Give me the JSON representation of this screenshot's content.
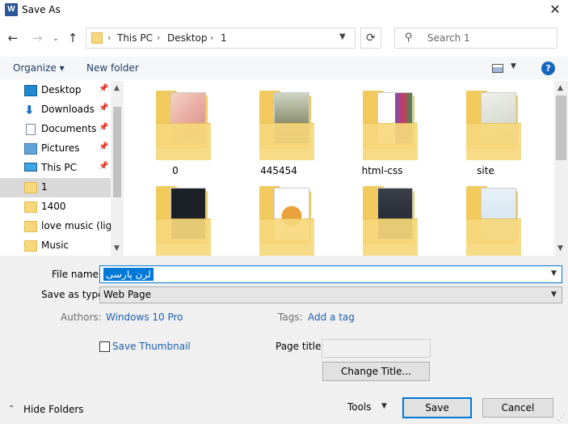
{
  "window": {
    "title": "Save As",
    "app_icon": "word-icon",
    "app_icon_letter": "W"
  },
  "nav": {
    "breadcrumbs": [
      "This PC",
      "Desktop",
      "1"
    ],
    "search_placeholder": "Search 1"
  },
  "toolbar": {
    "organize": "Organize",
    "new_folder": "New folder",
    "help": "?"
  },
  "sidebar": {
    "items": [
      {
        "label": "Desktop",
        "icon": "desktop-icon",
        "pinned": true
      },
      {
        "label": "Downloads",
        "icon": "download-icon",
        "pinned": true
      },
      {
        "label": "Documents",
        "icon": "documents-icon",
        "pinned": true
      },
      {
        "label": "Pictures",
        "icon": "pictures-icon",
        "pinned": true
      },
      {
        "label": "This PC",
        "icon": "computer-icon",
        "pinned": true
      },
      {
        "label": "1",
        "icon": "folder-icon",
        "selected": true
      },
      {
        "label": "1400",
        "icon": "folder-icon"
      },
      {
        "label": "love music (light",
        "icon": "folder-icon"
      },
      {
        "label": "Music",
        "icon": "folder-icon"
      }
    ]
  },
  "files": [
    {
      "name": "0",
      "preview": "photo-folder"
    },
    {
      "name": "445454",
      "preview": "photo-folder"
    },
    {
      "name": "html-css",
      "preview": "document-folder"
    },
    {
      "name": "site",
      "preview": "document-folder"
    },
    {
      "name": "",
      "preview": "dark-folder"
    },
    {
      "name": "",
      "preview": "music-folder"
    },
    {
      "name": "",
      "preview": "photo-folder"
    },
    {
      "name": "",
      "preview": "document-folder"
    }
  ],
  "form": {
    "file_name_label": "File name:",
    "file_name_value": "لرن پارسی",
    "save_type_label": "Save as type:",
    "save_type_value": "Web Page",
    "authors_label": "Authors:",
    "authors_value": "Windows 10 Pro",
    "tags_label": "Tags:",
    "tags_value": "Add a tag",
    "save_thumbnail_label": "Save Thumbnail",
    "page_title_label": "Page title:",
    "page_title_value": "",
    "change_title": "Change Title..."
  },
  "footer": {
    "hide_folders": "Hide Folders",
    "tools": "Tools",
    "save": "Save",
    "cancel": "Cancel"
  },
  "colors": {
    "accent": "#0078d7",
    "link": "#1e5fb0",
    "folder": "#f7d87c"
  }
}
